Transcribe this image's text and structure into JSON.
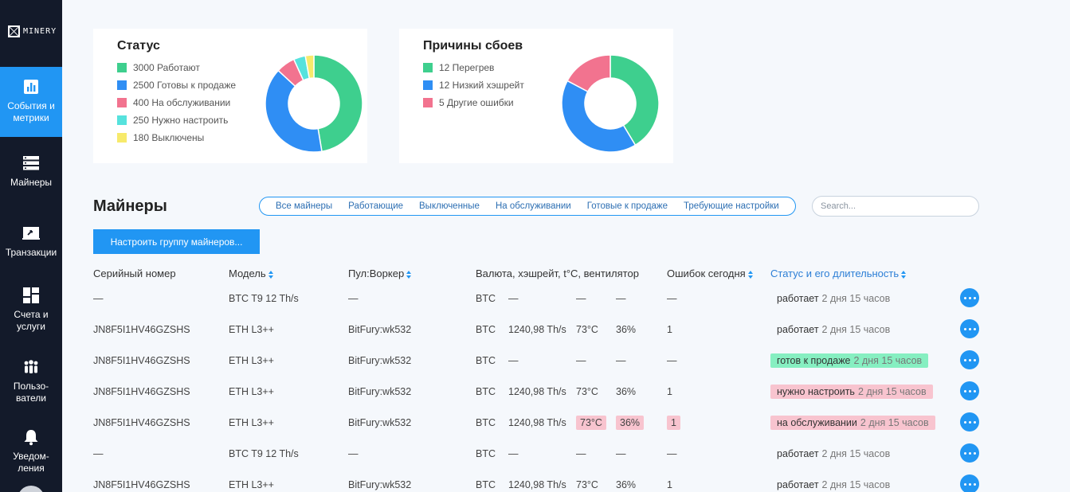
{
  "brand": {
    "name": "MINERY"
  },
  "nav": [
    {
      "label": "События и метрики",
      "icon": "bar-chart-icon",
      "active": true
    },
    {
      "label": "Майнеры",
      "icon": "server-icon",
      "active": false
    },
    {
      "label": "Транзакции",
      "icon": "transfer-icon",
      "active": false
    },
    {
      "label": "Счета и услуги",
      "icon": "grid-icon",
      "active": false
    },
    {
      "label": "Пользо-ватели",
      "icon": "users-icon",
      "active": false
    },
    {
      "label": "Уведом-ления",
      "icon": "bell-icon",
      "active": false
    }
  ],
  "status_card": {
    "title": "Статус",
    "legend": [
      {
        "text": "3000 Работают",
        "color": "#3ecf8e",
        "value": 3000
      },
      {
        "text": "2500 Готовы к продаже",
        "color": "#2f8ef4",
        "value": 2500
      },
      {
        "text": "400 На обслуживании",
        "color": "#f2738f",
        "value": 400
      },
      {
        "text": "250 Нужно настроить",
        "color": "#56e2dd",
        "value": 250
      },
      {
        "text": "180 Выключены",
        "color": "#f7ea6b",
        "value": 180
      }
    ]
  },
  "failures_card": {
    "title": "Причины сбоев",
    "legend": [
      {
        "text": "12 Перегрев",
        "color": "#3ecf8e",
        "value": 12
      },
      {
        "text": "12 Низкий хэшрейт",
        "color": "#2f8ef4",
        "value": 12
      },
      {
        "text": "5 Другие ошибки",
        "color": "#f2738f",
        "value": 5
      }
    ]
  },
  "miners": {
    "title": "Майнеры",
    "filters": [
      "Все майнеры",
      "Работающие",
      "Выключенные",
      "На обслуживании",
      "Готовые к продаже",
      "Требующие настройки"
    ],
    "search_placeholder": "Search...",
    "group_button": "Настроить группу майнеров...",
    "columns": {
      "serial": "Серийный номер",
      "model": "Модель",
      "pool": "Пул:Воркер",
      "currency": "Валюта, хэшрейт, t°C, вентилятор",
      "errors": "Ошибок сегодня",
      "status": "Статус и его длительность"
    },
    "rows": [
      {
        "serial": "—",
        "model": "BTC T9 12 Th/s",
        "pool": "—",
        "currency": "BTC",
        "hashrate": "—",
        "temp": "—",
        "fan": "—",
        "errors": "—",
        "status": "работает",
        "duration": "2 дня 15 часов",
        "status_bg": "",
        "alert": false
      },
      {
        "serial": "JN8F5I1HV46GZSHS",
        "model": "ETH L3++",
        "pool": "BitFury:wk532",
        "currency": "BTC",
        "hashrate": "1240,98 Th/s",
        "temp": "73°C",
        "fan": "36%",
        "errors": "1",
        "status": "работает",
        "duration": "2 дня 15 часов",
        "status_bg": "",
        "alert": false
      },
      {
        "serial": "JN8F5I1HV46GZSHS",
        "model": "ETH L3++",
        "pool": "BitFury:wk532",
        "currency": "BTC",
        "hashrate": "—",
        "temp": "—",
        "fan": "—",
        "errors": "—",
        "status": "готов к продаже",
        "duration": "2 дня 15 часов",
        "status_bg": "green",
        "alert": false
      },
      {
        "serial": "JN8F5I1HV46GZSHS",
        "model": "ETH L3++",
        "pool": "BitFury:wk532",
        "currency": "BTC",
        "hashrate": "1240,98 Th/s",
        "temp": "73°C",
        "fan": "36%",
        "errors": "1",
        "status": "нужно настроить",
        "duration": "2 дня 15 часов",
        "status_bg": "pink",
        "alert": false
      },
      {
        "serial": "JN8F5I1HV46GZSHS",
        "model": "ETH L3++",
        "pool": "BitFury:wk532",
        "currency": "BTC",
        "hashrate": "1240,98 Th/s",
        "temp": "73°C",
        "fan": "36%",
        "errors": "1",
        "status": "на обслуживании",
        "duration": "2 дня 15 часов",
        "status_bg": "pink",
        "alert": true
      },
      {
        "serial": "—",
        "model": "BTC T9 12 Th/s",
        "pool": "—",
        "currency": "BTC",
        "hashrate": "—",
        "temp": "—",
        "fan": "—",
        "errors": "—",
        "status": "работает",
        "duration": "2 дня 15 часов",
        "status_bg": "",
        "alert": false
      },
      {
        "serial": "JN8F5I1HV46GZSHS",
        "model": "ETH L3++",
        "pool": "BitFury:wk532",
        "currency": "BTC",
        "hashrate": "1240,98 Th/s",
        "temp": "73°C",
        "fan": "36%",
        "errors": "1",
        "status": "работает",
        "duration": "2 дня 15 часов",
        "status_bg": "",
        "alert": false
      }
    ]
  }
}
